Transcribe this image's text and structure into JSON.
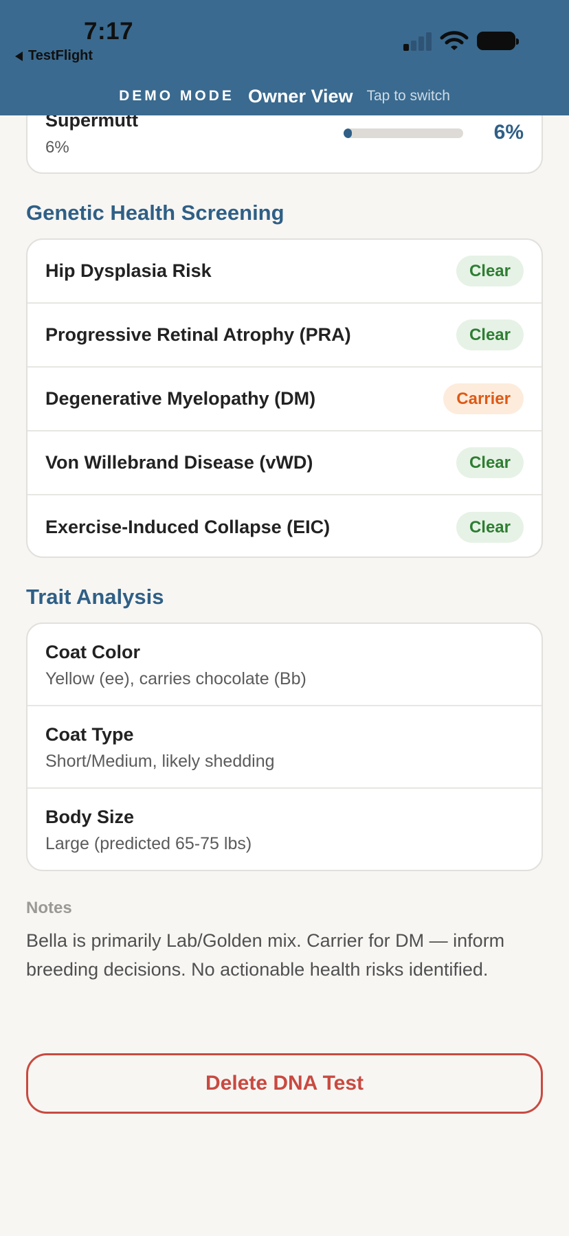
{
  "status_bar": {
    "time": "7:17",
    "back_app": "TestFlight"
  },
  "demo_bar": {
    "mode_label": "DEMO MODE",
    "view_label": "Owner View",
    "switch_hint": "Tap to switch"
  },
  "breed_partial": {
    "name": "Supermutt",
    "percent_text": "6%",
    "percent_display": "6%",
    "fraction": 0.06
  },
  "health": {
    "title": "Genetic Health Screening",
    "items": [
      {
        "label": "Hip Dysplasia Risk",
        "status": "Clear"
      },
      {
        "label": "Progressive Retinal Atrophy (PRA)",
        "status": "Clear"
      },
      {
        "label": "Degenerative Myelopathy (DM)",
        "status": "Carrier"
      },
      {
        "label": "Von Willebrand Disease (vWD)",
        "status": "Clear"
      },
      {
        "label": "Exercise-Induced Collapse (EIC)",
        "status": "Clear"
      }
    ]
  },
  "traits": {
    "title": "Trait Analysis",
    "items": [
      {
        "label": "Coat Color",
        "value": "Yellow (ee), carries chocolate (Bb)"
      },
      {
        "label": "Coat Type",
        "value": "Short/Medium, likely shedding"
      },
      {
        "label": "Body Size",
        "value": "Large (predicted 65-75 lbs)"
      }
    ]
  },
  "notes": {
    "label": "Notes",
    "text": "Bella is primarily Lab/Golden mix. Carrier for DM — inform breeding decisions. No actionable health risks identified."
  },
  "actions": {
    "delete_label": "Delete DNA Test"
  },
  "colors": {
    "header_bg": "#3a6a8f",
    "accent": "#2f5f86",
    "clear_text": "#2e7d32",
    "clear_bg": "#e6f2e6",
    "carrier_text": "#dd5a16",
    "carrier_bg": "#fdecdc",
    "danger": "#c84a40"
  }
}
